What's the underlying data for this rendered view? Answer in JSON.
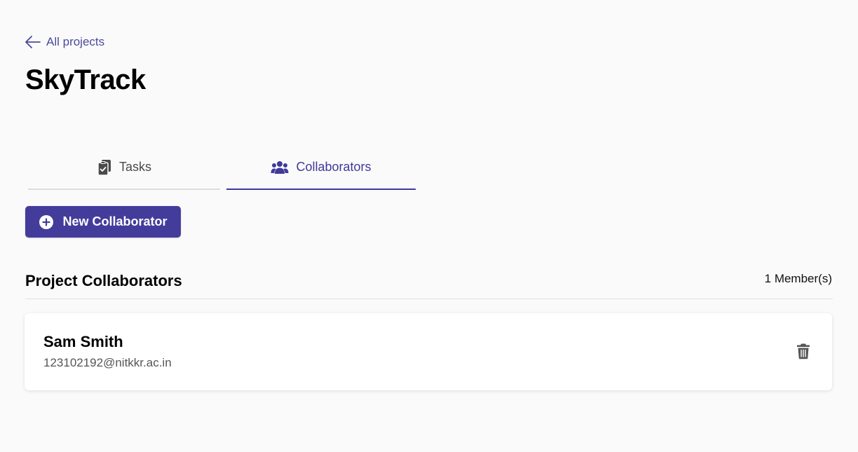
{
  "nav": {
    "back_label": "All projects"
  },
  "project": {
    "title": "SkyTrack"
  },
  "tabs": [
    {
      "label": "Tasks",
      "icon": "clipboard-check-icon",
      "active": false
    },
    {
      "label": "Collaborators",
      "icon": "users-icon",
      "active": true
    }
  ],
  "actions": {
    "new_collaborator_label": "New Collaborator",
    "icon": "plus-circle-icon"
  },
  "collaborators_section": {
    "title": "Project Collaborators",
    "member_count": "1 Member(s)",
    "members": [
      {
        "name": "Sam Smith",
        "email": "123102192@nitkkr.ac.in",
        "action_icon": "trash-icon"
      }
    ]
  },
  "colors": {
    "accent": "#433c9b",
    "background": "#fafafa",
    "tab_inactive": "#4a4a4a",
    "icon_gray": "#555555"
  }
}
